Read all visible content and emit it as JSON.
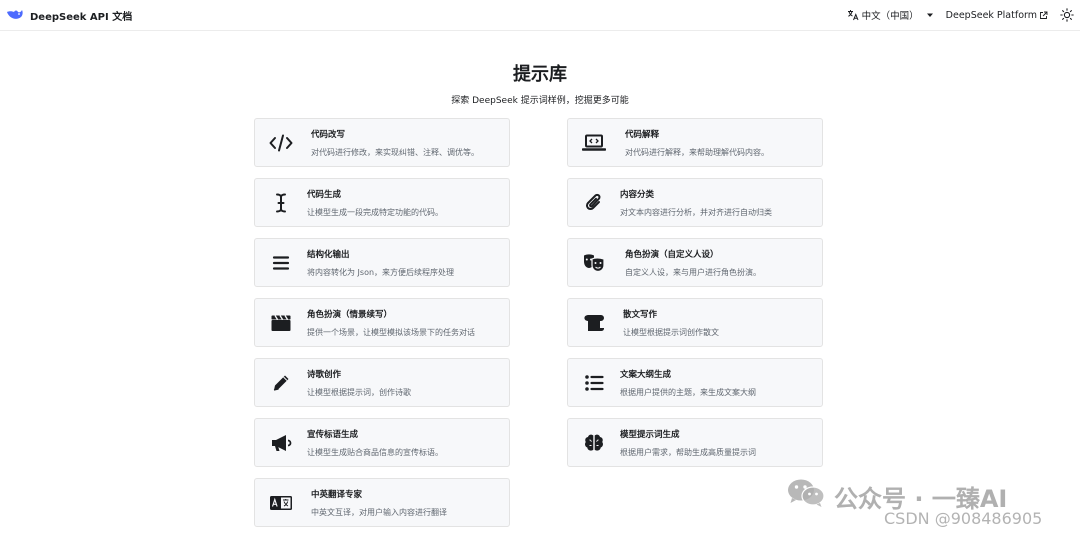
{
  "navbar": {
    "brand_title": "DeepSeek API 文档",
    "language": "中文（中国）",
    "platform_link": "DeepSeek Platform"
  },
  "page": {
    "title": "提示库",
    "subtitle": "探索 DeepSeek 提示词样例，挖掘更多可能"
  },
  "cards": [
    {
      "title": "代码改写",
      "desc": "对代码进行修改，来实现纠错、注释、调优等。",
      "icon": "code-icon"
    },
    {
      "title": "代码解释",
      "desc": "对代码进行解释，来帮助理解代码内容。",
      "icon": "laptop-code-icon"
    },
    {
      "title": "代码生成",
      "desc": "让模型生成一段完成特定功能的代码。",
      "icon": "text-cursor-icon"
    },
    {
      "title": "内容分类",
      "desc": "对文本内容进行分析，并对齐进行自动归类",
      "icon": "paperclip-icon"
    },
    {
      "title": "结构化输出",
      "desc": "将内容转化为 Json，来方便后续程序处理",
      "icon": "bars-icon"
    },
    {
      "title": "角色扮演（自定义人设）",
      "desc": "自定义人设，来与用户进行角色扮演。",
      "icon": "masks-icon"
    },
    {
      "title": "角色扮演（情景续写）",
      "desc": "提供一个场景，让模型模拟该场景下的任务对话",
      "icon": "clapperboard-icon"
    },
    {
      "title": "散文写作",
      "desc": "让模型根据提示词创作散文",
      "icon": "scroll-icon"
    },
    {
      "title": "诗歌创作",
      "desc": "让模型根据提示词，创作诗歌",
      "icon": "pencil-icon"
    },
    {
      "title": "文案大纲生成",
      "desc": "根据用户提供的主题，来生成文案大纲",
      "icon": "list-icon"
    },
    {
      "title": "宣传标语生成",
      "desc": "让模型生成贴合商品信息的宣传标语。",
      "icon": "megaphone-icon"
    },
    {
      "title": "模型提示词生成",
      "desc": "根据用户需求，帮助生成高质量提示词",
      "icon": "brain-icon"
    },
    {
      "title": "中英翻译专家",
      "desc": "中英文互译，对用户输入内容进行翻译",
      "icon": "language-icon"
    }
  ],
  "watermark": {
    "line1": "公众号 · 一臻AI",
    "line2": "CSDN @908486905"
  },
  "colors": {
    "card_bg": "#f7f8fa",
    "card_border": "#e3e3e3",
    "text": "#1c1e21",
    "muted_text": "#606770",
    "brand_blue": "#4D6BFE"
  }
}
